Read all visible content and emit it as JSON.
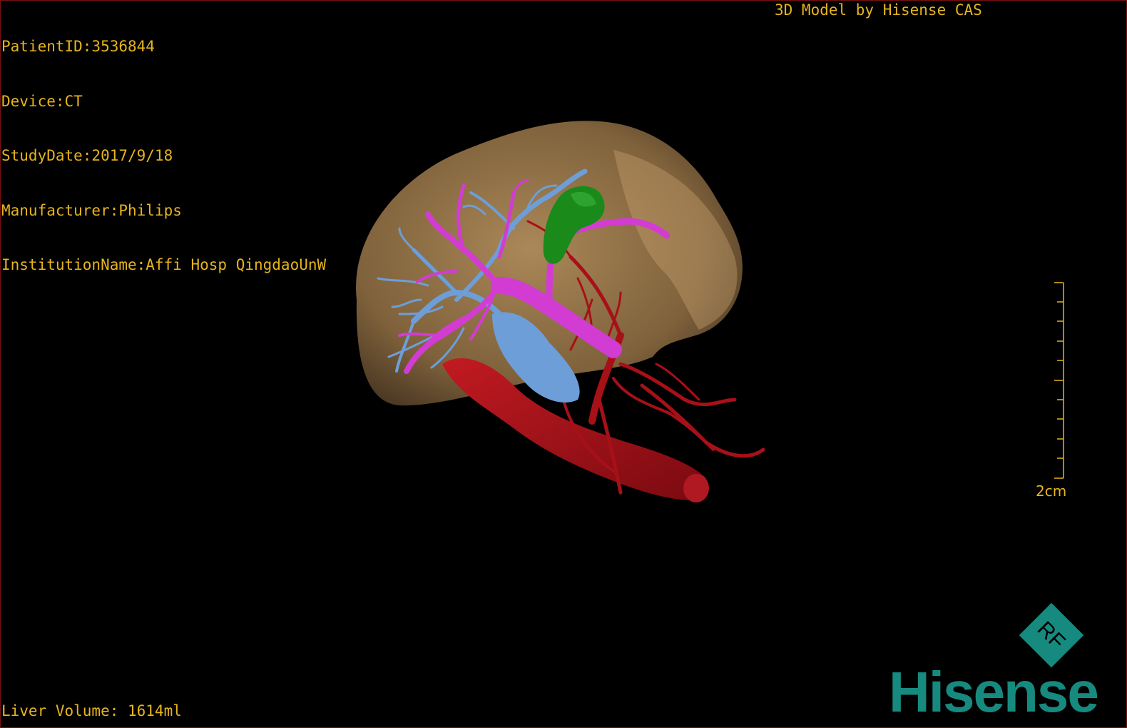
{
  "overlay": {
    "patient_id": "PatientID:3536844",
    "device": "Device:CT",
    "study_date": "StudyDate:2017/9/18",
    "manufacturer": "Manufacturer:Philips",
    "institution": "InstitutionName:Affi Hosp QingdaoUnW",
    "model_label": "3D Model by Hisense CAS",
    "liver_volume": "Liver Volume: 1614ml"
  },
  "scale": {
    "label": "2cm"
  },
  "logo": {
    "mark_text": "RF",
    "brand": "Hisense"
  },
  "colors": {
    "overlay_text": "#e6b41e",
    "liver": "#c49a62",
    "portal_vein": "#d23cd2",
    "hepatic_vein": "#6e9ed8",
    "artery_cava": "#a81018",
    "gallbladder": "#1a8a1a",
    "brand": "#178a80"
  }
}
